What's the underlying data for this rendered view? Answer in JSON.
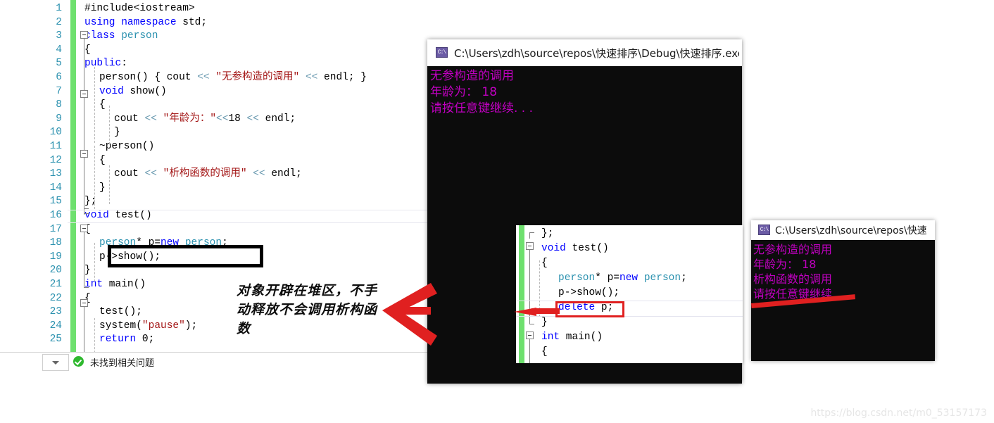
{
  "editor_main": {
    "line_numbers": [
      "1",
      "2",
      "3",
      "4",
      "5",
      "6",
      "7",
      "8",
      "9",
      "10",
      "11",
      "12",
      "13",
      "14",
      "15",
      "16",
      "17",
      "18",
      "19",
      "20",
      "21",
      "22",
      "23",
      "24",
      "25"
    ],
    "lines": [
      {
        "n": "1",
        "indent": 0,
        "tokens": [
          {
            "t": "#include",
            "c": "pl"
          },
          {
            "t": "<iostream>",
            "c": "pl"
          }
        ]
      },
      {
        "n": "2",
        "indent": 0,
        "tokens": [
          {
            "t": "using",
            "c": "k"
          },
          {
            "t": " ",
            "c": "pl"
          },
          {
            "t": "namespace",
            "c": "k"
          },
          {
            "t": " std;",
            "c": "pl"
          }
        ]
      },
      {
        "n": "3",
        "indent": 0,
        "tokens": [
          {
            "t": "class",
            "c": "k"
          },
          {
            "t": " ",
            "c": "pl"
          },
          {
            "t": "person",
            "c": "t"
          }
        ]
      },
      {
        "n": "4",
        "indent": 0,
        "tokens": [
          {
            "t": "{",
            "c": "pl"
          }
        ]
      },
      {
        "n": "5",
        "indent": 0,
        "tokens": [
          {
            "t": "public",
            "c": "k"
          },
          {
            "t": ":",
            "c": "pl"
          }
        ]
      },
      {
        "n": "6",
        "indent": 1,
        "tokens": [
          {
            "t": "person() { cout ",
            "c": "pl"
          },
          {
            "t": "<<",
            "c": "op"
          },
          {
            "t": " ",
            "c": "pl"
          },
          {
            "t": "\"无参构造的调用\"",
            "c": "s"
          },
          {
            "t": " ",
            "c": "pl"
          },
          {
            "t": "<<",
            "c": "op"
          },
          {
            "t": " endl; }",
            "c": "pl"
          }
        ]
      },
      {
        "n": "7",
        "indent": 1,
        "tokens": [
          {
            "t": "void",
            "c": "k"
          },
          {
            "t": " show()",
            "c": "pl"
          }
        ]
      },
      {
        "n": "8",
        "indent": 1,
        "tokens": [
          {
            "t": "{",
            "c": "pl"
          }
        ]
      },
      {
        "n": "9",
        "indent": 2,
        "tokens": [
          {
            "t": "cout ",
            "c": "pl"
          },
          {
            "t": "<<",
            "c": "op"
          },
          {
            "t": " ",
            "c": "pl"
          },
          {
            "t": "\"年龄为：\"",
            "c": "s"
          },
          {
            "t": "<<",
            "c": "op"
          },
          {
            "t": "18 ",
            "c": "pl"
          },
          {
            "t": "<<",
            "c": "op"
          },
          {
            "t": " endl;",
            "c": "pl"
          }
        ]
      },
      {
        "n": "10",
        "indent": 2,
        "tokens": [
          {
            "t": "}",
            "c": "pl"
          }
        ]
      },
      {
        "n": "11",
        "indent": 1,
        "tokens": [
          {
            "t": "~person()",
            "c": "pl"
          }
        ]
      },
      {
        "n": "12",
        "indent": 1,
        "tokens": [
          {
            "t": "{",
            "c": "pl"
          }
        ]
      },
      {
        "n": "13",
        "indent": 2,
        "tokens": [
          {
            "t": "cout ",
            "c": "pl"
          },
          {
            "t": "<<",
            "c": "op"
          },
          {
            "t": " ",
            "c": "pl"
          },
          {
            "t": "\"析构函数的调用\"",
            "c": "s"
          },
          {
            "t": " ",
            "c": "pl"
          },
          {
            "t": "<<",
            "c": "op"
          },
          {
            "t": " endl;",
            "c": "pl"
          }
        ]
      },
      {
        "n": "14",
        "indent": 1,
        "tokens": [
          {
            "t": "}",
            "c": "pl"
          }
        ]
      },
      {
        "n": "15",
        "indent": 0,
        "tokens": [
          {
            "t": "};",
            "c": "pl"
          }
        ]
      },
      {
        "n": "16",
        "indent": 0,
        "tokens": [
          {
            "t": "void",
            "c": "k"
          },
          {
            "t": " test()",
            "c": "pl"
          }
        ]
      },
      {
        "n": "17",
        "indent": 0,
        "tokens": [
          {
            "t": "{",
            "c": "pl"
          }
        ]
      },
      {
        "n": "18",
        "indent": 1,
        "tokens": [
          {
            "t": "person",
            "c": "t"
          },
          {
            "t": "* p=",
            "c": "pl"
          },
          {
            "t": "new",
            "c": "k"
          },
          {
            "t": " ",
            "c": "pl"
          },
          {
            "t": "person",
            "c": "t"
          },
          {
            "t": ";",
            "c": "pl"
          }
        ]
      },
      {
        "n": "19",
        "indent": 1,
        "tokens": [
          {
            "t": "p->show();",
            "c": "pl"
          }
        ]
      },
      {
        "n": "20",
        "indent": 0,
        "tokens": [
          {
            "t": "}",
            "c": "pl"
          }
        ]
      },
      {
        "n": "21",
        "indent": 0,
        "tokens": [
          {
            "t": "int",
            "c": "k"
          },
          {
            "t": " main()",
            "c": "pl"
          }
        ]
      },
      {
        "n": "22",
        "indent": 0,
        "tokens": [
          {
            "t": "{",
            "c": "pl"
          }
        ]
      },
      {
        "n": "23",
        "indent": 1,
        "tokens": [
          {
            "t": "test();",
            "c": "pl"
          }
        ]
      },
      {
        "n": "24",
        "indent": 1,
        "tokens": [
          {
            "t": "system(",
            "c": "pl"
          },
          {
            "t": "\"pause\"",
            "c": "s"
          },
          {
            "t": ");",
            "c": "pl"
          }
        ]
      },
      {
        "n": "25",
        "indent": 1,
        "tokens": [
          {
            "t": "return",
            "c": "k"
          },
          {
            "t": " 0;",
            "c": "pl"
          }
        ]
      }
    ],
    "status_text": "未找到相关问题",
    "highlight_box_label": "person* p=new person;"
  },
  "editor_snippet": {
    "lines": [
      {
        "indent": 0,
        "tokens": [
          {
            "t": "};",
            "c": "pl"
          }
        ]
      },
      {
        "indent": 0,
        "tokens": [
          {
            "t": "void",
            "c": "k"
          },
          {
            "t": " test()",
            "c": "pl"
          }
        ]
      },
      {
        "indent": 0,
        "tokens": [
          {
            "t": "{",
            "c": "pl"
          }
        ]
      },
      {
        "indent": 1,
        "tokens": [
          {
            "t": "person",
            "c": "t"
          },
          {
            "t": "* p=",
            "c": "pl"
          },
          {
            "t": "new",
            "c": "k"
          },
          {
            "t": " ",
            "c": "pl"
          },
          {
            "t": "person",
            "c": "t"
          },
          {
            "t": ";",
            "c": "pl"
          }
        ]
      },
      {
        "indent": 1,
        "tokens": [
          {
            "t": "p->show();",
            "c": "pl"
          }
        ]
      },
      {
        "indent": 1,
        "tokens": [
          {
            "t": "delete",
            "c": "k"
          },
          {
            "t": " p;",
            "c": "pl"
          }
        ]
      },
      {
        "indent": 0,
        "tokens": [
          {
            "t": "}",
            "c": "pl"
          }
        ]
      },
      {
        "indent": 0,
        "tokens": [
          {
            "t": "int",
            "c": "k"
          },
          {
            "t": " main()",
            "c": "pl"
          }
        ]
      },
      {
        "indent": 0,
        "tokens": [
          {
            "t": "{",
            "c": "pl"
          }
        ]
      }
    ],
    "highlight_box_label": "delete p;"
  },
  "console1": {
    "title": "C:\\Users\\zdh\\source\\repos\\快速排序\\Debug\\快速排序.exe",
    "icon": "console-app-icon",
    "icon_glyph": "C:\\",
    "output_lines": [
      "无参构造的调用",
      "年龄为： 18",
      "请按任意键继续. . ."
    ]
  },
  "console2": {
    "title": "C:\\Users\\zdh\\source\\repos\\快速",
    "icon": "console-app-icon",
    "icon_glyph": "C:\\",
    "output_lines": [
      "无参构造的调用",
      "年龄为： 18",
      "析构函数的调用",
      "请按任意键继续. . ."
    ]
  },
  "annotation": {
    "text": "对象开辟在堆区，不手动释放不会调用析构函数",
    "arrow_color": "#e02020"
  },
  "watermark": {
    "text": "https://blog.csdn.net/m0_53157173"
  },
  "colors": {
    "keyword": "#0000ff",
    "type": "#2b91af",
    "string": "#a31515",
    "operator": "#6a9ab0",
    "line_number": "#2b91af",
    "change_bar": "#6ee06e",
    "console_bg": "#0c0c0c",
    "console_text": "#c000c0",
    "red_box": "#e02020",
    "black_box": "#000000"
  }
}
